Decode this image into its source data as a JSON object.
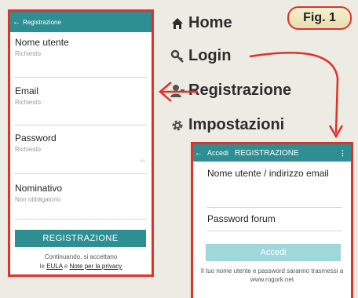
{
  "figure_label": "Fig. 1",
  "left_screen": {
    "title": "Registrazione",
    "fields": [
      {
        "label": "Nome utente",
        "hint": "Richiesto"
      },
      {
        "label": "Email",
        "hint": "Richiesto"
      },
      {
        "label": "Password",
        "hint": "Richiesto"
      },
      {
        "label": "Nominativo",
        "hint": "Non obbligatorio"
      }
    ],
    "button": "REGISTRAZIONE",
    "terms_prefix": "Continuando, si accettano",
    "terms_le": "le",
    "eula": "EULA",
    "terms_and": "e",
    "privacy": "Note per la privacy"
  },
  "menu": {
    "items": [
      {
        "label": "Home",
        "icon": "home-icon"
      },
      {
        "label": "Login",
        "icon": "key-icon"
      },
      {
        "label": "Registrazione",
        "icon": "person-add-icon"
      },
      {
        "label": "Impostazioni",
        "icon": "gear-icon"
      }
    ]
  },
  "right_screen": {
    "tab_login": "Accedi",
    "tab_register": "REGISTRAZIONE",
    "username_label": "Nome utente / indirizzo email",
    "password_label": "Password forum",
    "button": "Accedi",
    "note": "Il tuo nome utente e password saranno trasmessi a www.rogork.net"
  },
  "colors": {
    "accent": "#2e8f93",
    "highlight": "#e0322b",
    "background": "#ecebe4"
  }
}
